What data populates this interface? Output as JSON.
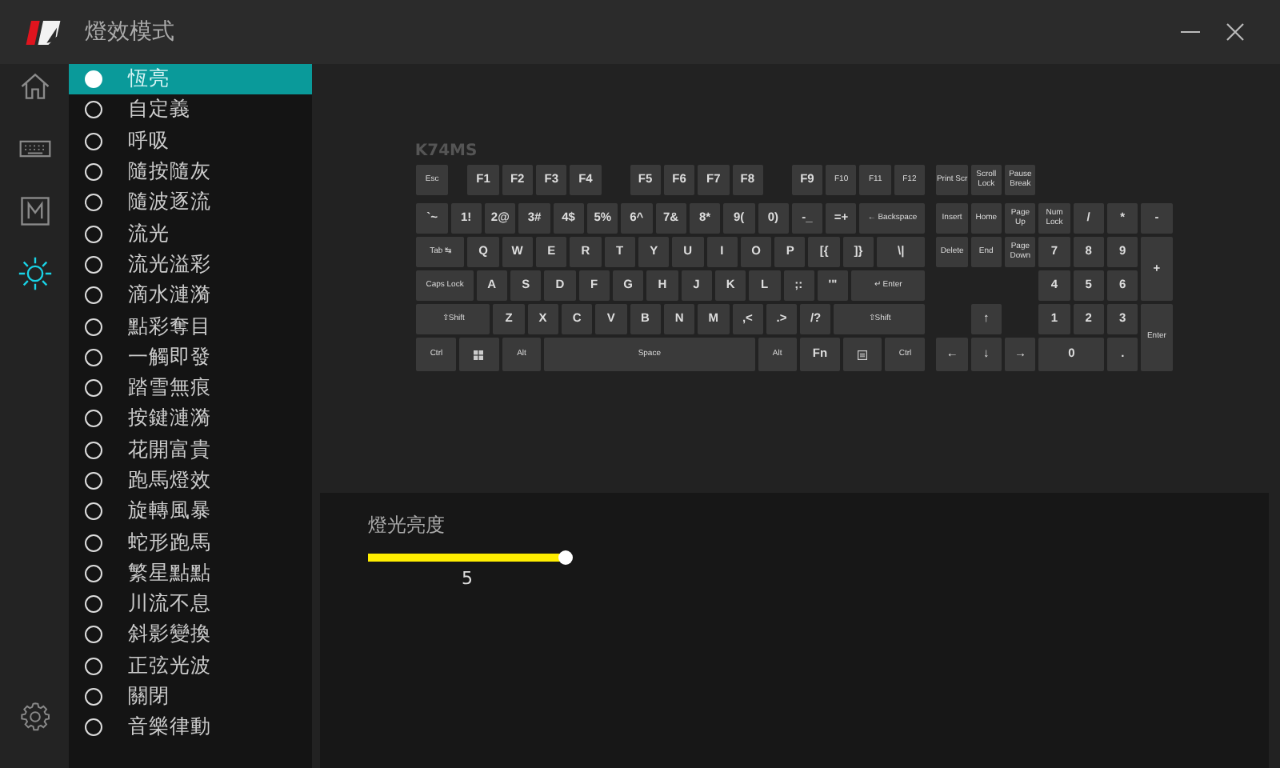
{
  "window": {
    "title": "燈效模式"
  },
  "rail": [
    {
      "selected": false
    },
    {
      "selected": false
    },
    {
      "selected": false
    },
    {
      "selected": true
    }
  ],
  "effects": [
    {
      "label": "恆亮",
      "selected": true
    },
    {
      "label": "自定義",
      "selected": false
    },
    {
      "label": "呼吸",
      "selected": false
    },
    {
      "label": "隨按隨灰",
      "selected": false
    },
    {
      "label": "隨波逐流",
      "selected": false
    },
    {
      "label": "流光",
      "selected": false
    },
    {
      "label": "流光溢彩",
      "selected": false
    },
    {
      "label": "滴水漣漪",
      "selected": false
    },
    {
      "label": "點彩奪目",
      "selected": false
    },
    {
      "label": "一觸即發",
      "selected": false
    },
    {
      "label": "踏雪無痕",
      "selected": false
    },
    {
      "label": "按鍵漣漪",
      "selected": false
    },
    {
      "label": "花開富貴",
      "selected": false
    },
    {
      "label": "跑馬燈效",
      "selected": false
    },
    {
      "label": "旋轉風暴",
      "selected": false
    },
    {
      "label": "蛇形跑馬",
      "selected": false
    },
    {
      "label": "繁星點點",
      "selected": false
    },
    {
      "label": "川流不息",
      "selected": false
    },
    {
      "label": "斜影變換",
      "selected": false
    },
    {
      "label": "正弦光波",
      "selected": false
    },
    {
      "label": "關閉",
      "selected": false
    },
    {
      "label": "音樂律動",
      "selected": false
    }
  ],
  "keyboard": {
    "model": "K74MS",
    "main": {
      "keys": [
        "Esc",
        "F1",
        "F2",
        "F3",
        "F4",
        "F5",
        "F6",
        "F7",
        "F8",
        "F9",
        "F10",
        "F11",
        "F12",
        "`~",
        "1!",
        "2@",
        "3#",
        "4$",
        "5%",
        "6^",
        "7&",
        "8*",
        "9(",
        "0)",
        "-_",
        "=+",
        "← Backspace",
        "Tab ↹",
        "Q",
        "W",
        "E",
        "R",
        "T",
        "Y",
        "U",
        "I",
        "O",
        "P",
        "[{",
        "]}",
        "\\|",
        "Caps Lock",
        "A",
        "S",
        "D",
        "F",
        "G",
        "H",
        "J",
        "K",
        "L",
        ";:",
        "'\"",
        "↵ Enter",
        "⇧Shift",
        "Z",
        "X",
        "C",
        "V",
        "B",
        "N",
        "M",
        ",<",
        ".>",
        "/?",
        "⇧Shift",
        "Ctrl",
        {
          "kind": "windows"
        },
        "Alt",
        "Space",
        "Alt",
        "Fn",
        {
          "kind": "menu"
        },
        "Ctrl"
      ]
    },
    "nav": {
      "keys": [
        "Print Scr",
        "Scroll Lock",
        "Pause Break",
        "Insert",
        "Home",
        "Page Up",
        "Delete",
        "End",
        "Page Down"
      ]
    },
    "arrows": {
      "keys": [
        "↑",
        "←",
        "↓",
        "→"
      ]
    },
    "numpad": {
      "keys": [
        "Num Lock",
        "/",
        "*",
        "-",
        "7",
        "8",
        "9",
        "+",
        "4",
        "5",
        "6",
        "1",
        "2",
        "3",
        "Enter",
        "0",
        "."
      ]
    }
  },
  "brightness": {
    "label": "燈光亮度",
    "level": 1.0,
    "reading": "5"
  }
}
